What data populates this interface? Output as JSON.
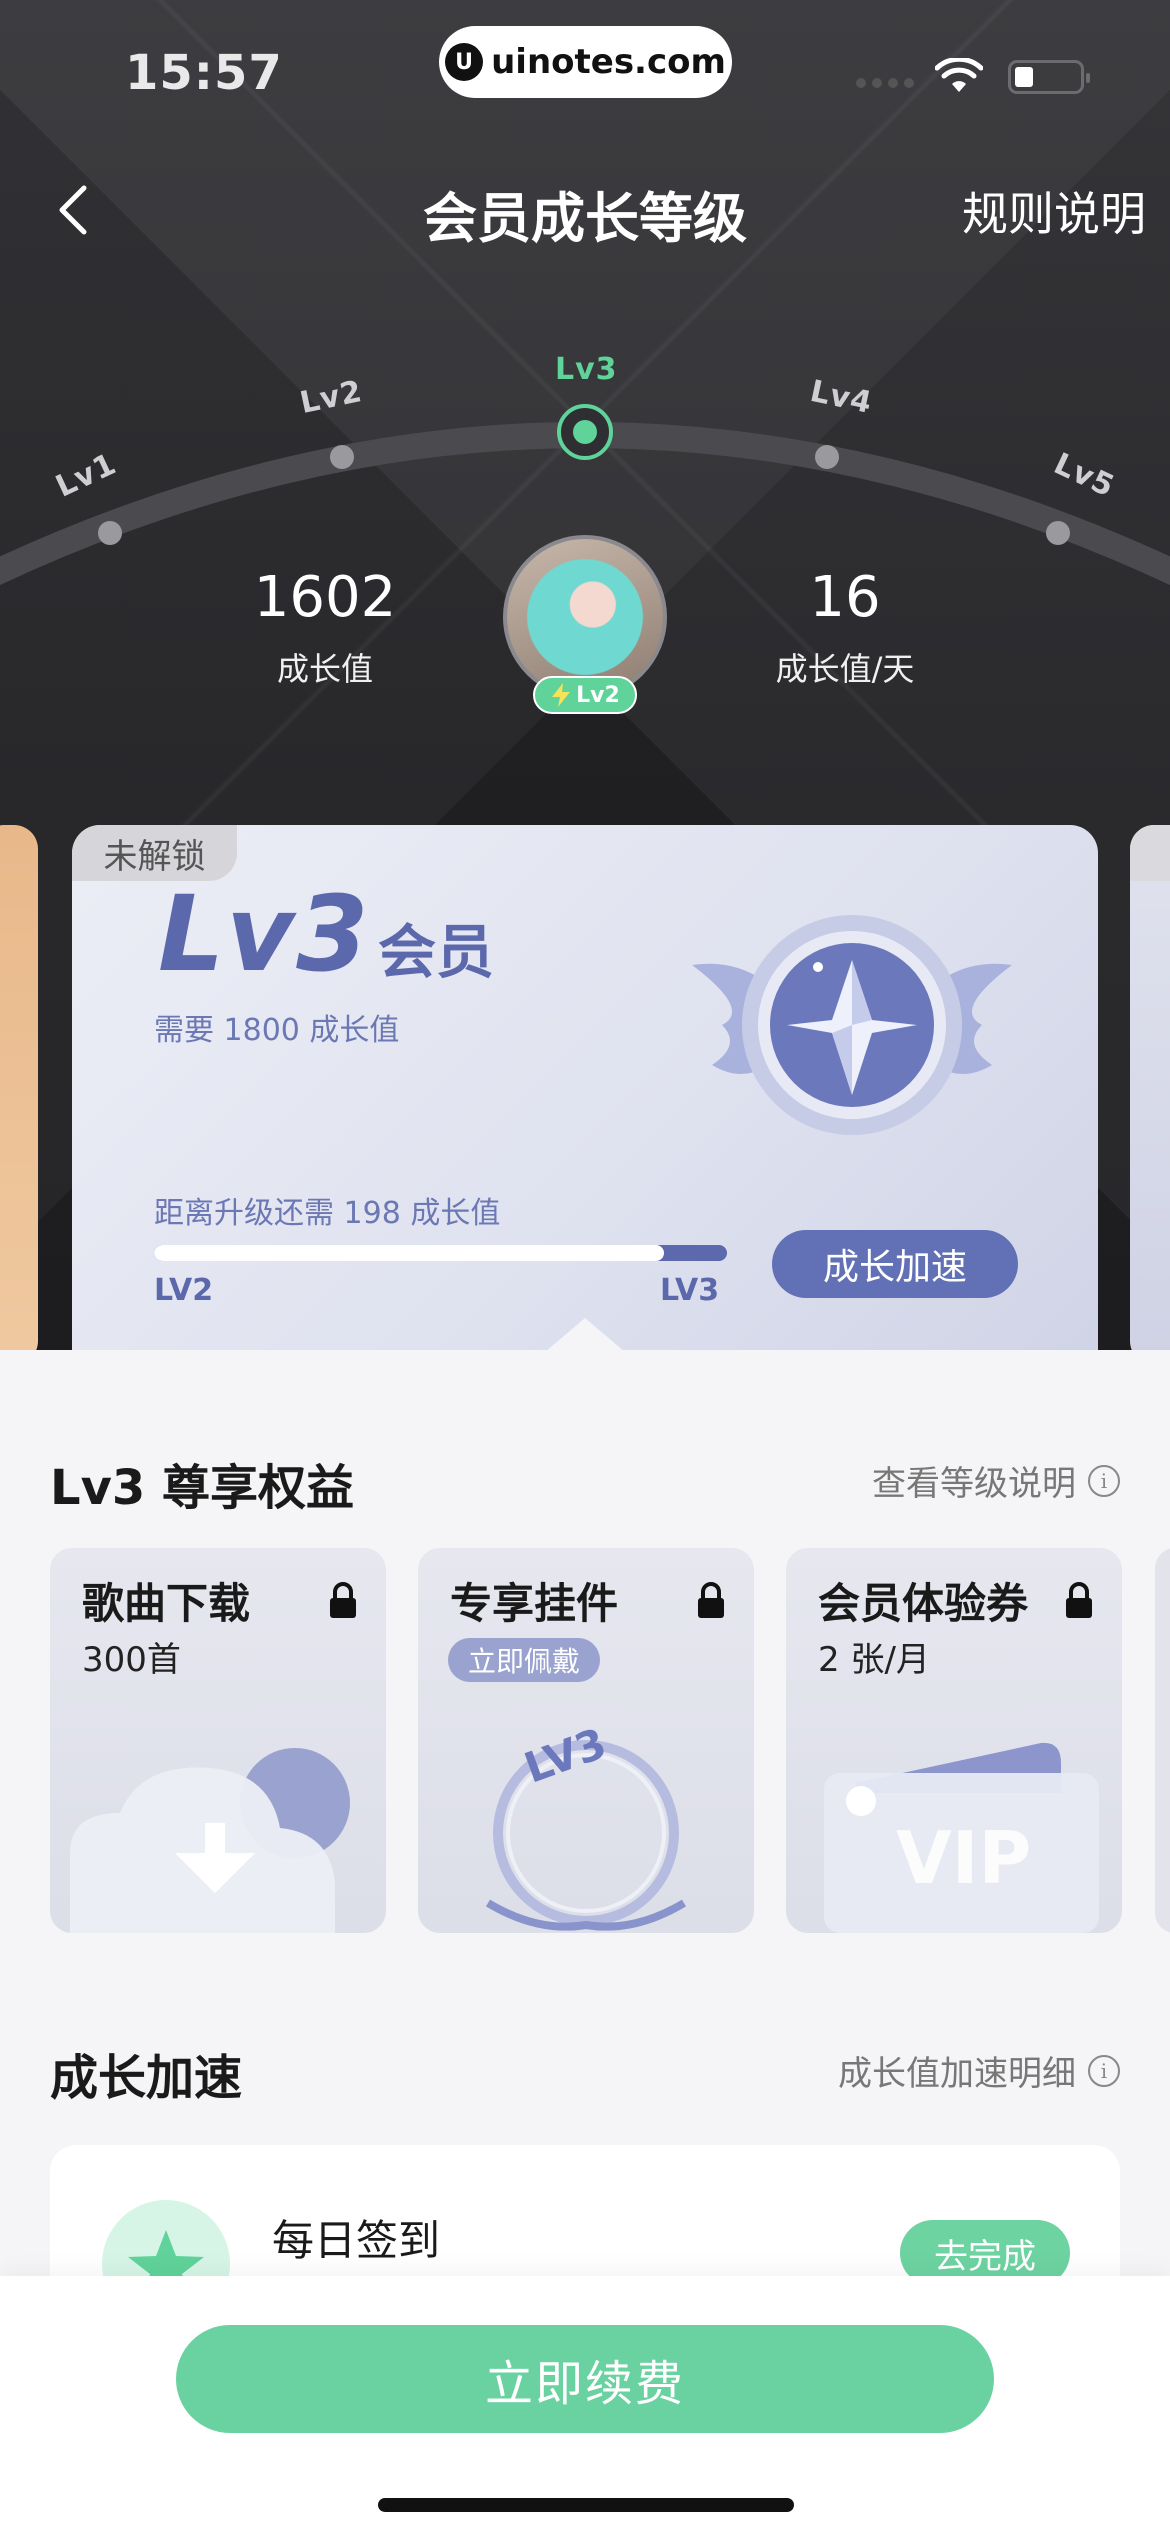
{
  "status_bar": {
    "time": "15:57",
    "watermark": "uinotes.com"
  },
  "nav": {
    "title": "会员成长等级",
    "rules": "规则说明"
  },
  "levels": [
    "Lv1",
    "Lv2",
    "Lv3",
    "Lv4",
    "Lv5"
  ],
  "current_level_index": 2,
  "stats": {
    "growth_value": "1602",
    "growth_value_label": "成长值",
    "daily_growth": "16",
    "daily_growth_label": "成长值/天"
  },
  "avatar_badge": "Lv2",
  "level_card": {
    "lock_tag": "未解锁",
    "level": "Lv3",
    "member": "会员",
    "need_text": "需要 1800 成长值",
    "remain_text": "距离升级还需 198 成长值",
    "progress_fraction": 0.89,
    "from_label": "LV2",
    "to_label": "LV3",
    "boost_button": "成长加速"
  },
  "benefits_section": {
    "title": "Lv3 尊享权益",
    "link": "查看等级说明",
    "items": [
      {
        "title": "歌曲下载",
        "sub": "300首",
        "art": "cloud-download"
      },
      {
        "title": "专享挂件",
        "chip": "立即佩戴",
        "art": "lv3-frame"
      },
      {
        "title": "会员体验券",
        "sub": "2 张/月",
        "art": "vip-coupon"
      }
    ],
    "frame_text": "LV3",
    "vip_text": "VIP"
  },
  "boost_section": {
    "title": "成长加速",
    "link": "成长值加速明细",
    "task": {
      "name": "每日签到",
      "button": "去完成"
    }
  },
  "bottom": {
    "renew_button": "立即续费"
  },
  "colors": {
    "accent_green": "#69d2a0",
    "level_blue": "#5b69ac",
    "hero_dark": "#1f1f22"
  }
}
